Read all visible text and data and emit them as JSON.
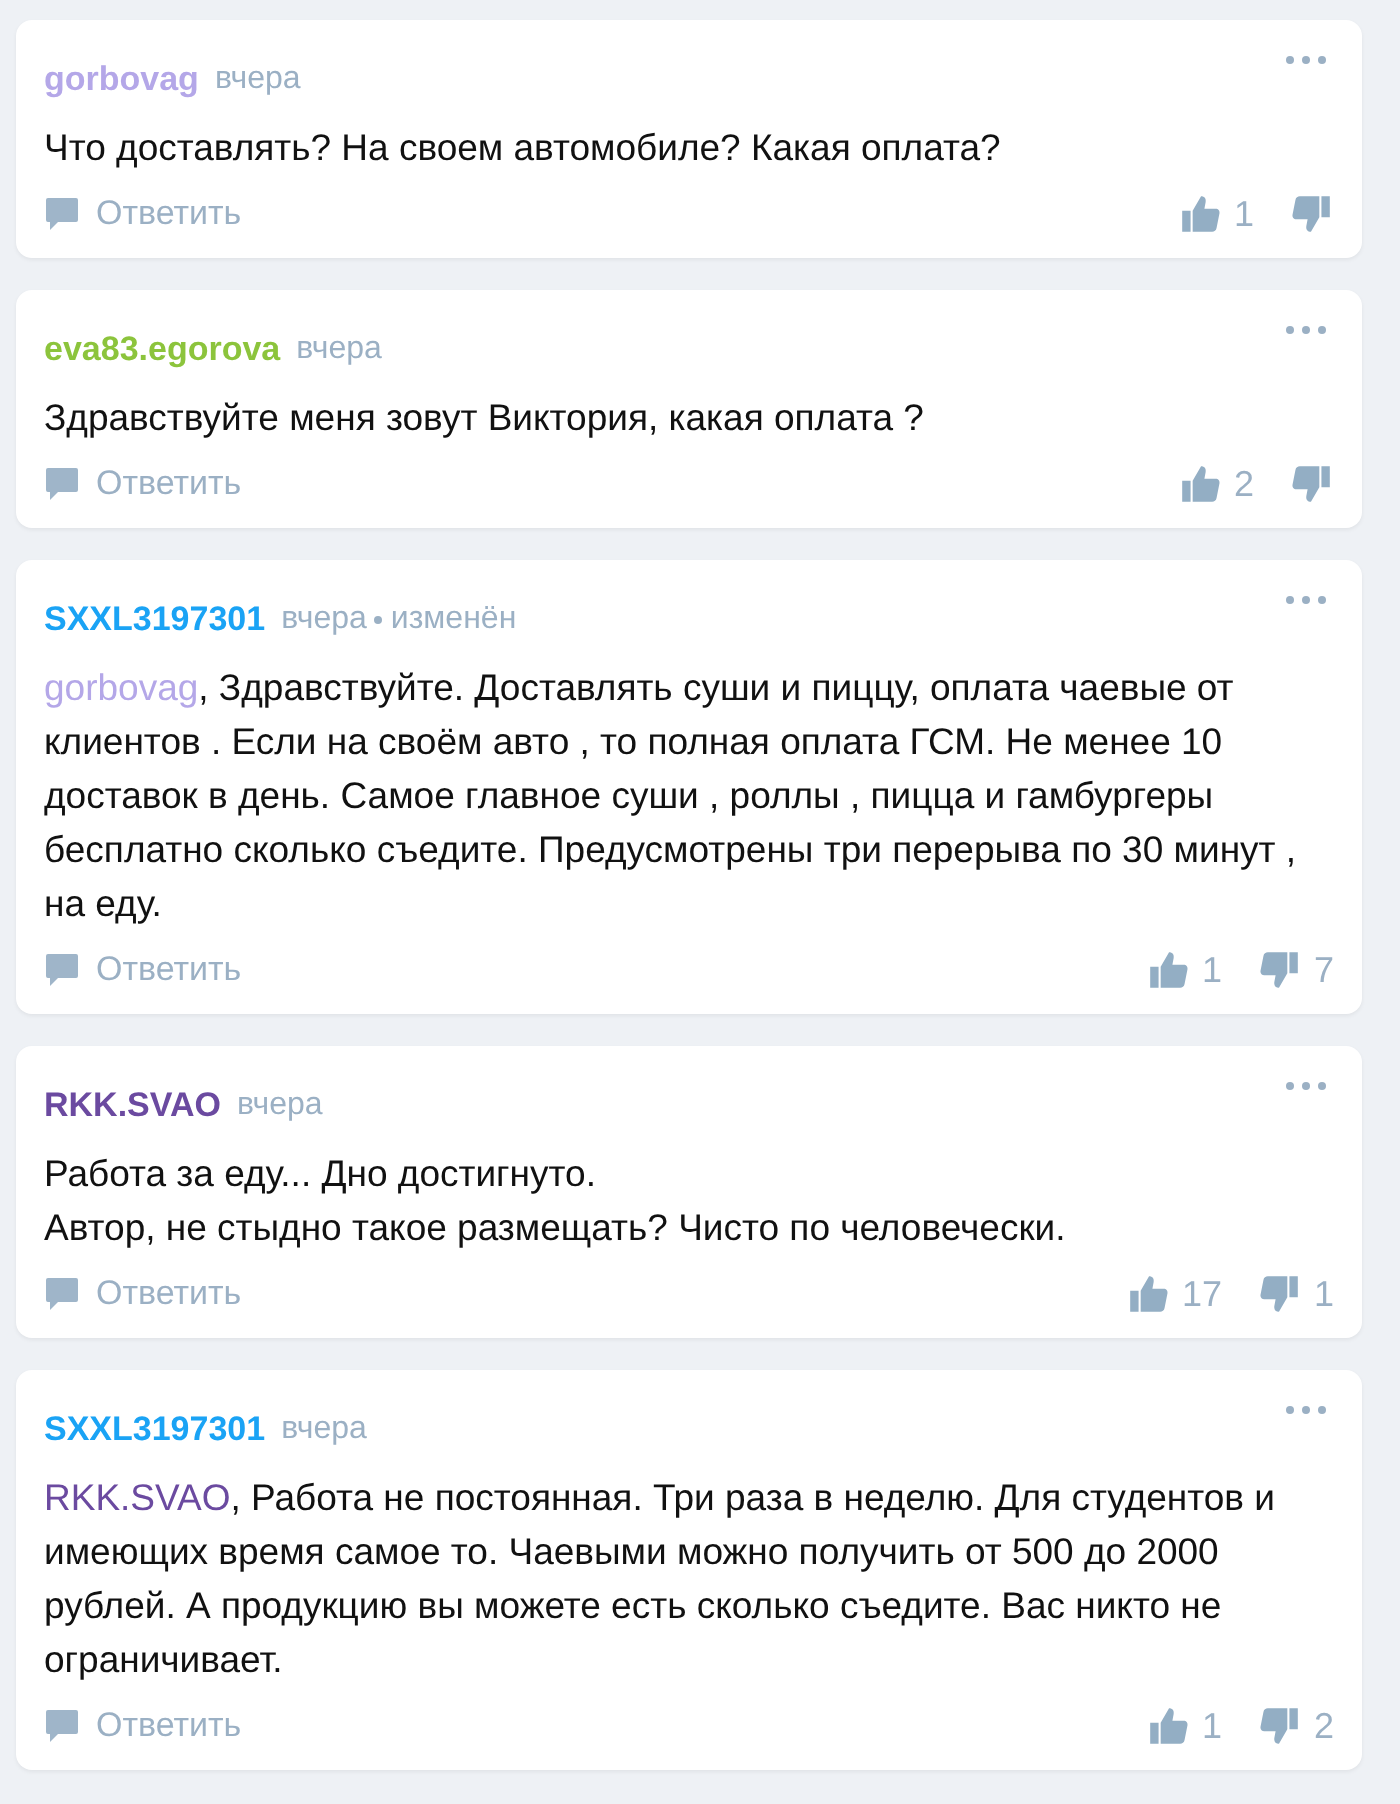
{
  "comments": [
    {
      "author": {
        "name": "gorbovag",
        "color": "#b4a7e8"
      },
      "time": "вчера",
      "lines": [
        {
          "text": "Что доставлять? На своем автомобиле? Какая оплата?"
        }
      ],
      "reply": "Ответить",
      "likes": "1"
    },
    {
      "author": {
        "name": "eva83.egorova",
        "color": "#8cc43c"
      },
      "time": "вчера",
      "lines": [
        {
          "text": "Здравствуйте меня зовут Виктория, какая оплата ?"
        }
      ],
      "reply": "Ответить",
      "likes": "2"
    },
    {
      "author": {
        "name": "SXXL3197301",
        "color": "#1aa3f5"
      },
      "time": "вчера",
      "edited": "изменён",
      "lines": [
        {
          "mention": {
            "name": "gorbovag",
            "color": "#b4a7e8"
          },
          "text": ", Здравствуйте. Доставлять суши и пиццу, оплата чаевые от клиентов . Если на своём авто , то полная оплата ГСМ. Не менее 10 доставок в день. Самое главное суши , роллы , пицца и гамбургеры бесплатно сколько съедите. Предусмотрены три перерыва по 30 минут , на еду."
        }
      ],
      "reply": "Ответить",
      "likes": "1",
      "dislikes": "7"
    },
    {
      "author": {
        "name": "RKK.SVAO",
        "color": "#6b4aa0"
      },
      "time": "вчера",
      "lines": [
        {
          "text": "Работа за еду... Дно достигнуто."
        },
        {
          "text": "Автор, не стыдно такое размещать? Чисто по человечески."
        }
      ],
      "reply": "Ответить",
      "likes": "17",
      "dislikes": "1"
    },
    {
      "author": {
        "name": "SXXL3197301",
        "color": "#1aa3f5"
      },
      "time": "вчера",
      "lines": [
        {
          "mention": {
            "name": "RKK.SVAO",
            "color": "#6b4aa0"
          },
          "text": ", Работа не постоянная. Три раза в неделю. Для студентов и имеющих время самое то. Чаевыми можно получить от 500 до 2000 рублей. А продукцию вы можете есть сколько съедите. Вас никто не ограничивает."
        }
      ],
      "reply": "Ответить",
      "likes": "1",
      "dislikes": "2"
    }
  ]
}
